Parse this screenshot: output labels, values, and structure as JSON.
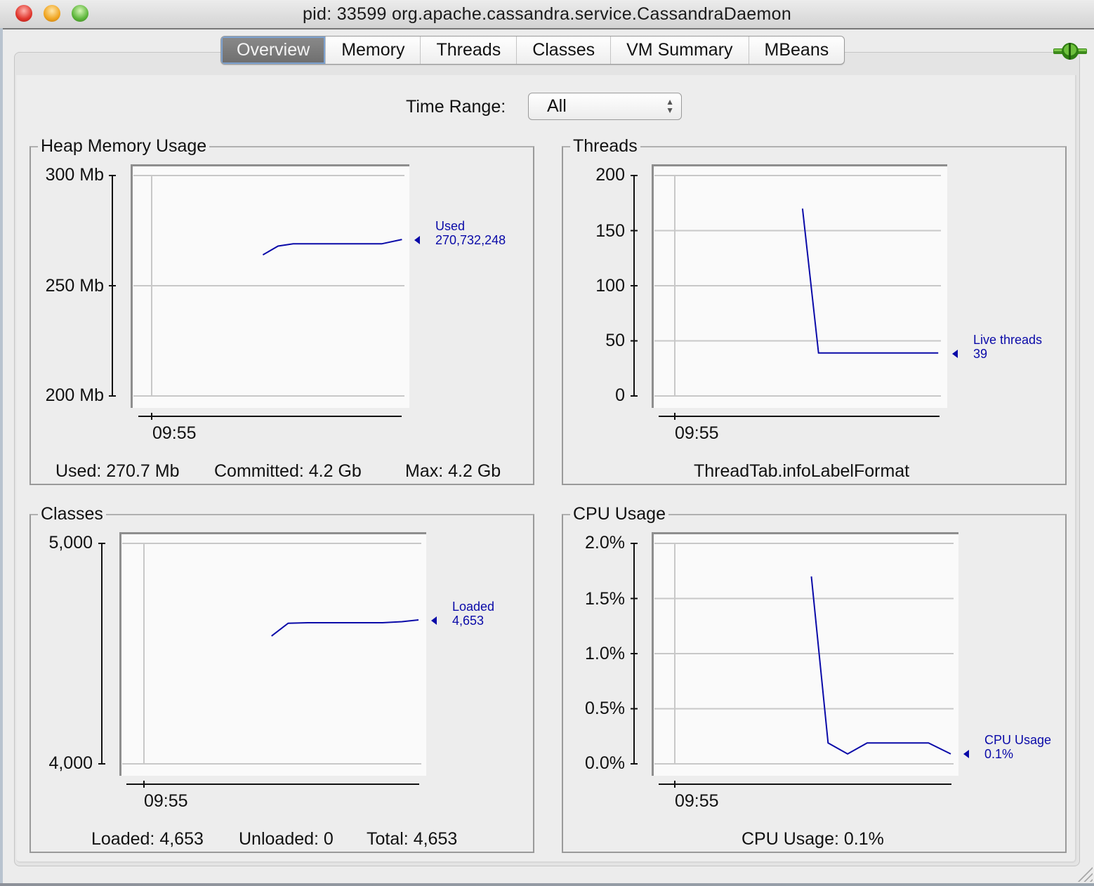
{
  "window": {
    "title": "pid: 33599 org.apache.cassandra.service.CassandraDaemon"
  },
  "tabs": [
    {
      "label": "Overview",
      "active": true
    },
    {
      "label": "Memory",
      "active": false
    },
    {
      "label": "Threads",
      "active": false
    },
    {
      "label": "Classes",
      "active": false
    },
    {
      "label": "VM Summary",
      "active": false
    },
    {
      "label": "MBeans",
      "active": false
    }
  ],
  "connection_icon": "connected-plug-icon",
  "time_range": {
    "label": "Time Range:",
    "selected": "All"
  },
  "colors": {
    "series": "#0a0aa8",
    "grid": "#c8c8c8",
    "plot_bg": "#fafafa"
  },
  "panels": {
    "heap": {
      "title": "Heap Memory Usage",
      "info": [
        "Used: 270.7 Mb",
        "Committed: 4.2 Gb",
        "Max: 4.2 Gb"
      ],
      "legend_name": "Used",
      "legend_value": "270,732,248"
    },
    "threads": {
      "title": "Threads",
      "info": [
        "ThreadTab.infoLabelFormat"
      ],
      "legend_name": "Live threads",
      "legend_value": "39"
    },
    "classes": {
      "title": "Classes",
      "info": [
        "Loaded: 4,653",
        "Unloaded: 0",
        "Total: 4,653"
      ],
      "legend_name": "Loaded",
      "legend_value": "4,653"
    },
    "cpu": {
      "title": "CPU Usage",
      "info": [
        "CPU Usage: 0.1%"
      ],
      "legend_name": "CPU Usage",
      "legend_value": "0.1%"
    }
  },
  "chart_data": [
    {
      "id": "heap",
      "type": "line",
      "title": "Heap Memory Usage",
      "xlabel": "",
      "ylabel": "",
      "x_tick_labels": [
        "09:55"
      ],
      "y_tick_labels": [
        "200 Mb",
        "250 Mb",
        "300 Mb"
      ],
      "y_ticks": [
        200,
        250,
        300
      ],
      "ylim": [
        200,
        300
      ],
      "x_range": [
        0,
        10
      ],
      "series": [
        {
          "name": "Used",
          "x": [
            4.4,
            5.0,
            5.6,
            9.1,
            9.9
          ],
          "y": [
            264,
            268,
            269,
            269,
            271
          ]
        }
      ]
    },
    {
      "id": "threads",
      "type": "line",
      "title": "Threads",
      "xlabel": "",
      "ylabel": "",
      "x_tick_labels": [
        "09:55"
      ],
      "y_tick_labels": [
        "0",
        "50",
        "100",
        "150",
        "200"
      ],
      "y_ticks": [
        0,
        50,
        100,
        150,
        200
      ],
      "ylim": [
        0,
        200
      ],
      "x_range": [
        0,
        10
      ],
      "series": [
        {
          "name": "Live threads",
          "x": [
            4.8,
            5.4,
            9.9
          ],
          "y": [
            170,
            39,
            39
          ]
        }
      ]
    },
    {
      "id": "classes",
      "type": "line",
      "title": "Classes",
      "xlabel": "",
      "ylabel": "",
      "x_tick_labels": [
        "09:55"
      ],
      "y_tick_labels": [
        "4,000",
        "5,000"
      ],
      "y_ticks": [
        4000,
        5000
      ],
      "ylim": [
        4000,
        5000
      ],
      "x_range": [
        0,
        10
      ],
      "series": [
        {
          "name": "Loaded",
          "x": [
            4.6,
            5.2,
            5.9,
            8.6,
            9.3,
            9.9
          ],
          "y": [
            4580,
            4638,
            4640,
            4640,
            4645,
            4653
          ]
        }
      ]
    },
    {
      "id": "cpu",
      "type": "line",
      "title": "CPU Usage",
      "xlabel": "",
      "ylabel": "",
      "x_tick_labels": [
        "09:55"
      ],
      "y_tick_labels": [
        "0.0%",
        "0.5%",
        "1.0%",
        "1.5%",
        "2.0%"
      ],
      "y_ticks": [
        0,
        0.5,
        1.0,
        1.5,
        2.0
      ],
      "ylim": [
        0,
        2.0
      ],
      "x_range": [
        0,
        10
      ],
      "series": [
        {
          "name": "CPU Usage",
          "x": [
            4.9,
            5.5,
            6.2,
            6.9,
            9.1,
            9.9
          ],
          "y": [
            1.7,
            0.19,
            0.09,
            0.19,
            0.19,
            0.09
          ]
        }
      ]
    }
  ]
}
